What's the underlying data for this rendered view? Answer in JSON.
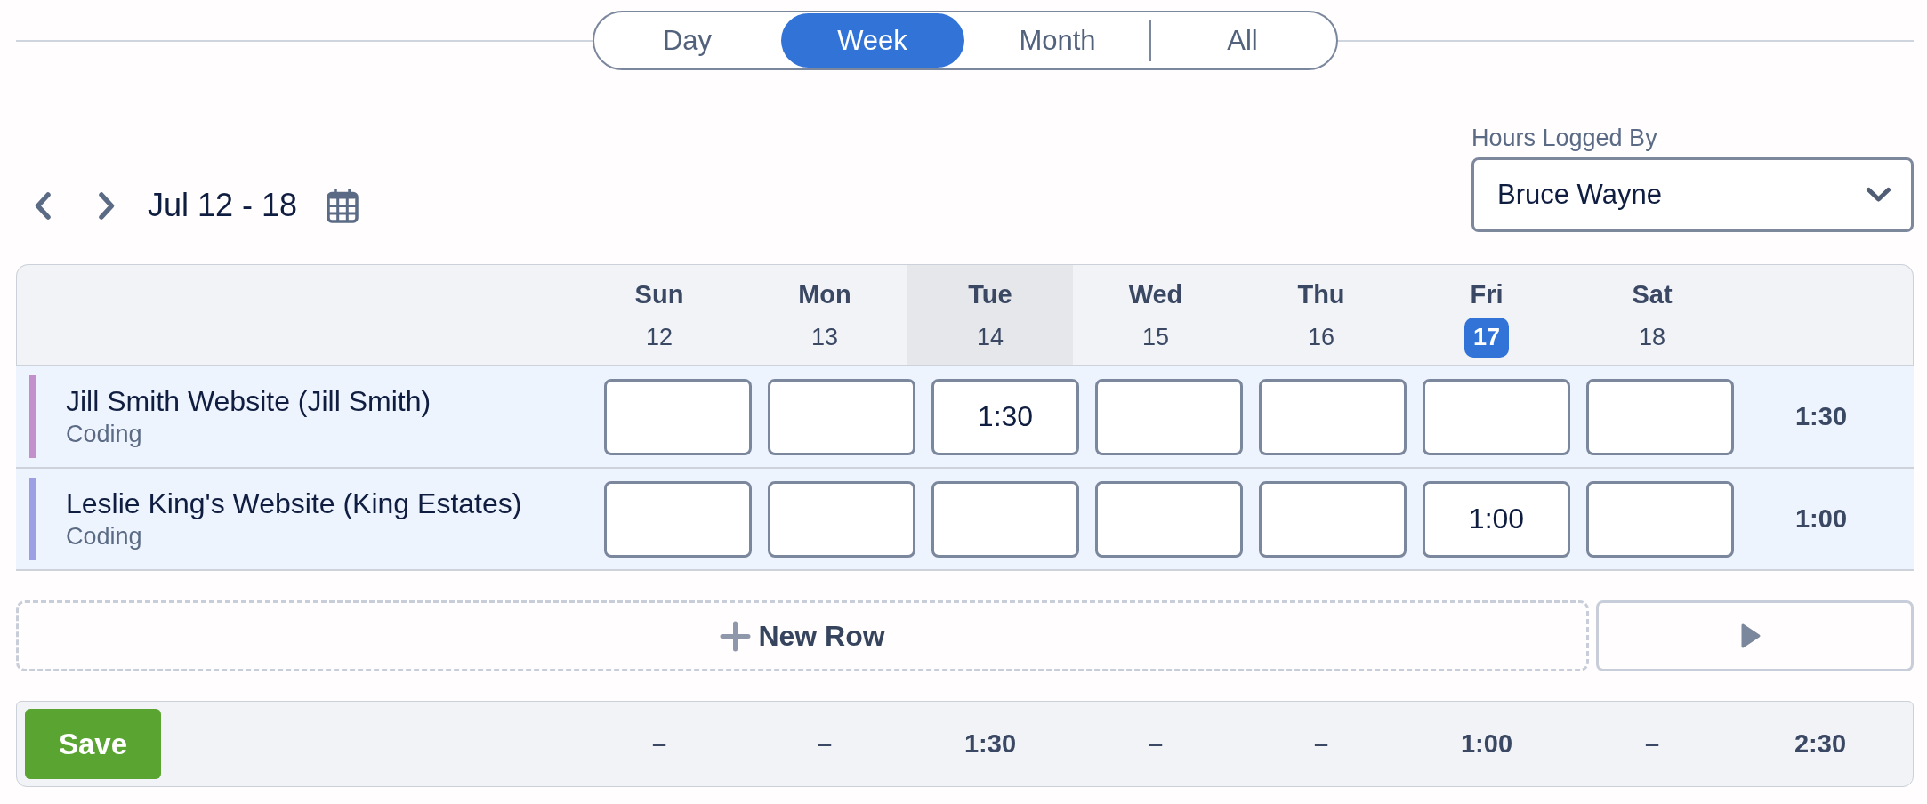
{
  "view_tabs": [
    {
      "label": "Day",
      "selected": false
    },
    {
      "label": "Week",
      "selected": true
    },
    {
      "label": "Month",
      "selected": false
    },
    {
      "label": "All",
      "selected": false
    }
  ],
  "date_range": {
    "label": "Jul 12 - 18"
  },
  "hours_logged_by": {
    "label": "Hours Logged By",
    "value": "Bruce Wayne"
  },
  "timesheet": {
    "days": [
      {
        "name": "Sun",
        "date": "12",
        "highlighted": false,
        "today": false
      },
      {
        "name": "Mon",
        "date": "13",
        "highlighted": false,
        "today": false
      },
      {
        "name": "Tue",
        "date": "14",
        "highlighted": true,
        "today": false
      },
      {
        "name": "Wed",
        "date": "15",
        "highlighted": false,
        "today": false
      },
      {
        "name": "Thu",
        "date": "16",
        "highlighted": false,
        "today": false
      },
      {
        "name": "Fri",
        "date": "17",
        "highlighted": false,
        "today": true
      },
      {
        "name": "Sat",
        "date": "18",
        "highlighted": false,
        "today": false
      }
    ],
    "rows": [
      {
        "project": "Jill Smith Website (Jill Smith)",
        "task": "Coding",
        "color": "#c490cc",
        "entries": {
          "tue": "1:30"
        },
        "total": "1:30"
      },
      {
        "project": "Leslie King's Website (King Estates)",
        "task": "Coding",
        "color": "#9c9fe3",
        "entries": {
          "fri": "1:00"
        },
        "total": "1:00"
      }
    ]
  },
  "new_row_button": {
    "label": "New Row"
  },
  "footer": {
    "save_button": "Save",
    "day_totals": [
      "–",
      "–",
      "1:30",
      "–",
      "–",
      "1:00",
      "–"
    ],
    "grand_total": "2:30"
  }
}
